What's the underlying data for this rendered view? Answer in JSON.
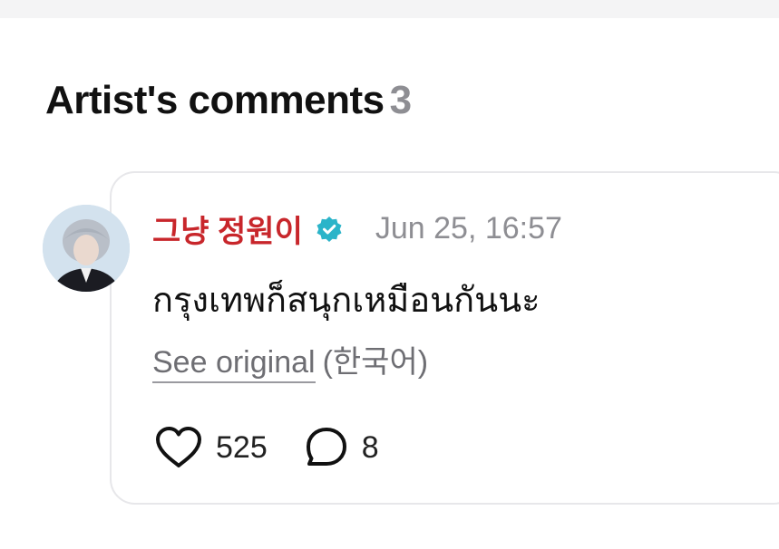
{
  "section": {
    "title": "Artist's comments",
    "count": "3"
  },
  "comment": {
    "author": "그냥 정원이",
    "verified_icon": "verified-badge-icon",
    "timestamp": "Jun 25, 16:57",
    "text": "กรุงเทพก็สนุกเหมือนกันนะ",
    "see_original_label": "See original",
    "original_language": "(한국어)",
    "likes": "525",
    "replies": "8"
  },
  "colors": {
    "author": "#c8262b",
    "verified": "#2bb4c9",
    "muted": "#8e8e93"
  }
}
